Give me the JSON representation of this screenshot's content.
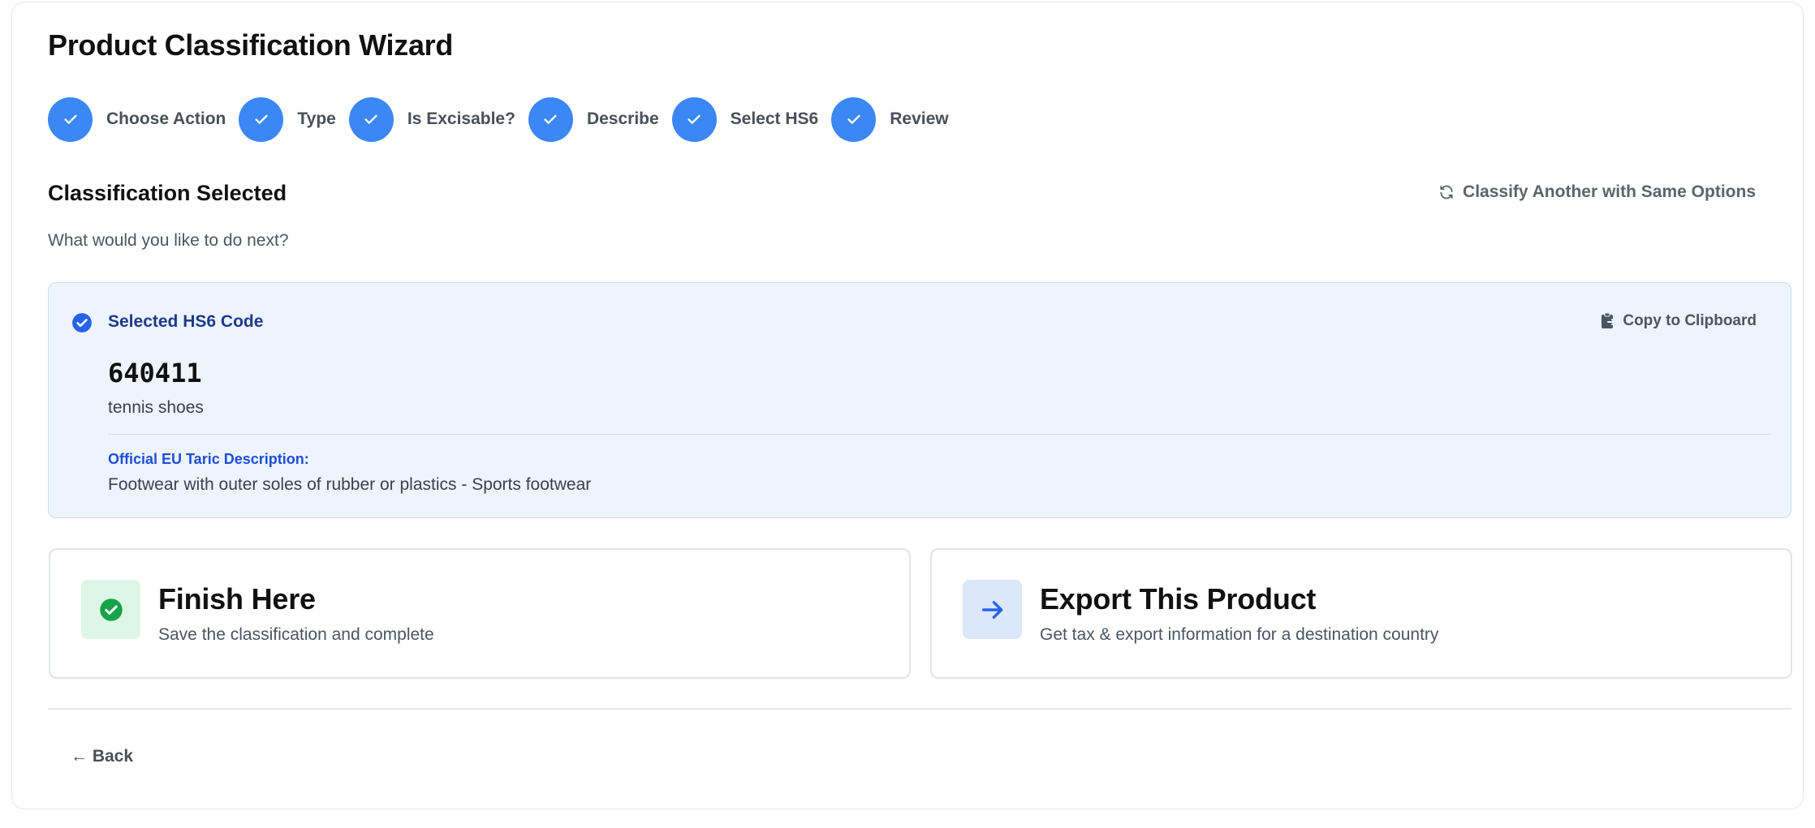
{
  "header": {
    "title": "Product Classification Wizard"
  },
  "steps": [
    {
      "label": "Choose Action",
      "status": "complete"
    },
    {
      "label": "Type",
      "status": "complete"
    },
    {
      "label": "Is Excisable?",
      "status": "complete"
    },
    {
      "label": "Describe",
      "status": "complete"
    },
    {
      "label": "Select HS6",
      "status": "complete"
    },
    {
      "label": "Review",
      "status": "complete"
    }
  ],
  "section": {
    "title": "Classification Selected",
    "subtitle": "What would you like to do next?",
    "classify_another_label": "Classify Another with Same Options"
  },
  "selection": {
    "label": "Selected HS6 Code",
    "copy_label": "Copy to Clipboard",
    "code": "640411",
    "description": "tennis shoes",
    "taric_label": "Official EU Taric Description:",
    "taric_description": "Footwear with outer soles of rubber or plastics - Sports footwear"
  },
  "actions": {
    "finish": {
      "title": "Finish Here",
      "subtitle": "Save the classification and complete"
    },
    "export": {
      "title": "Export This Product",
      "subtitle": "Get tax & export information for a destination country"
    }
  },
  "footer": {
    "back_label": "← Back"
  },
  "colors": {
    "step_complete": "#3b87f5",
    "panel_bg": "#eef4fd",
    "finish_icon_bg": "#ddf7e6",
    "finish_icon": "#16a34a",
    "export_icon_bg": "#dbe8fb",
    "export_icon": "#2563eb"
  }
}
